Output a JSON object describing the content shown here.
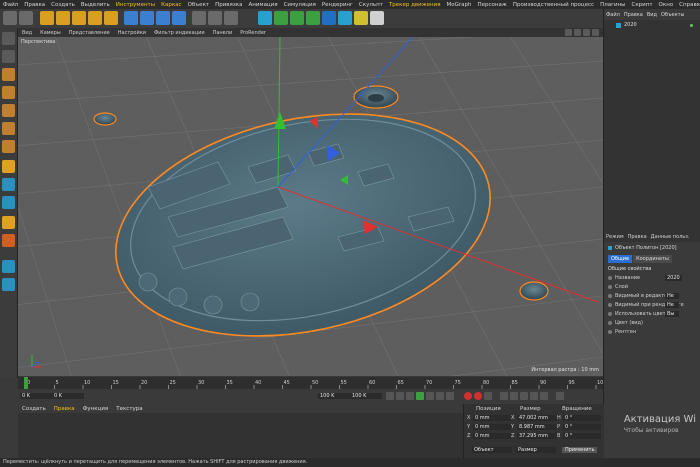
{
  "menubar": {
    "items": [
      "Файл",
      "Правка",
      "Создать",
      "Выделить",
      "Инструменты",
      "Каркас",
      "Объект",
      "Привязка",
      "Анимация",
      "Симуляция",
      "Рендеринг",
      "Скульпт",
      "Трекер движения",
      "MoGraph",
      "Персонаж",
      "Производственный процесс",
      "Плагины",
      "Скрипт",
      "Окно",
      "Справка"
    ],
    "highlight_color": "#f0c020"
  },
  "viewport": {
    "menu": [
      "Вид",
      "Камеры",
      "Представление",
      "Настройки",
      "Фильтр индикации",
      "Панели",
      "ProRender"
    ],
    "label": "Перспектива",
    "grid_info": "Интервал растра : 10 mm"
  },
  "object_manager": {
    "menu": [
      "Файл",
      "Правка",
      "Вид",
      "Объекты"
    ],
    "object_name": "2020"
  },
  "attributes": {
    "tabs": [
      "Режим",
      "Правка",
      "Данные польз."
    ],
    "header": "Объект Полигон [2020]",
    "subtabs": [
      "Общие",
      "Координаты"
    ],
    "section": "Общие свойства",
    "rows": [
      {
        "label": "Название",
        "value": "2020"
      },
      {
        "label": "Слой",
        "value": ""
      },
      {
        "label": "Видимый в редакторе",
        "value": "Не"
      },
      {
        "label": "Видимый при рендеринге",
        "value": "Не"
      },
      {
        "label": "Использовать цвет",
        "value": "Вы"
      },
      {
        "label": "Цвет (вид)",
        "value": ""
      },
      {
        "label": "Рентген",
        "value": ""
      }
    ]
  },
  "timeline": {
    "ticks": [
      "0",
      "5",
      "10",
      "15",
      "20",
      "25",
      "30",
      "35",
      "40",
      "45",
      "50",
      "55",
      "60",
      "65",
      "70",
      "75",
      "80",
      "85",
      "90",
      "95",
      "100"
    ],
    "current_frame": "0 K",
    "start": "0 K",
    "end_fields": [
      "100 K",
      "100 K"
    ]
  },
  "material_manager": {
    "tabs": [
      "Создать",
      "Правка",
      "Функция",
      "Текстура"
    ]
  },
  "coordinates": {
    "headers": [
      "Позиция",
      "Размер",
      "Вращение"
    ],
    "rows": [
      {
        "axis": "X",
        "pos": "0 mm",
        "size": "47.002 mm",
        "rot_axis": "H",
        "rot": "0 °"
      },
      {
        "axis": "Y",
        "pos": "0 mm",
        "size": "8.987 mm",
        "rot_axis": "P",
        "rot": "0 °"
      },
      {
        "axis": "Z",
        "pos": "0 mm",
        "size": "37.295 mm",
        "rot_axis": "B",
        "rot": "0 °"
      }
    ],
    "mode_object": "Объект",
    "mode_size": "Размер",
    "apply": "Применить"
  },
  "status": "Переместить: щёлкнуть и перетащить для перемещения элементов. Нажать SHIFT для растрирования движения.",
  "watermark": {
    "line1": "Активация Wi",
    "line2": "Чтобы активиров"
  },
  "colors": {
    "selection": "#ff8a20",
    "model": "#4e6a78",
    "axis_x": "#e03030",
    "axis_y": "#30c030",
    "axis_z": "#3060e0"
  }
}
